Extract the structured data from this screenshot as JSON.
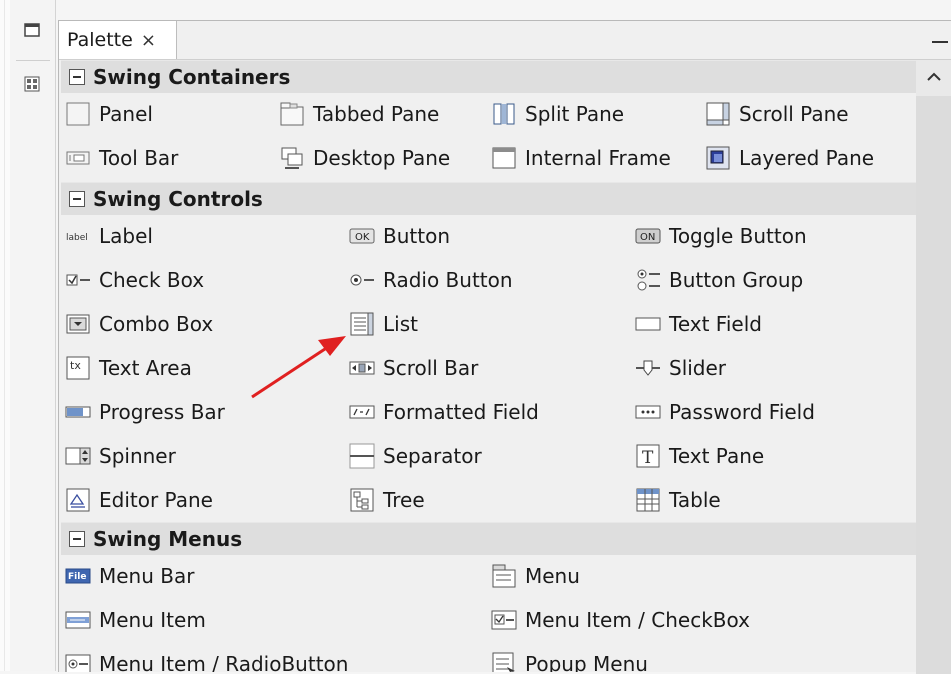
{
  "palette": {
    "tab_label": "Palette",
    "tab_close": "×"
  },
  "colors": {
    "category_bg": "#dedede",
    "panel_bg": "#f0f0f0",
    "annotation_arrow": "#e02020"
  },
  "categories": [
    {
      "label": "Swing Containers"
    },
    {
      "label": "Swing Controls"
    },
    {
      "label": "Swing Menus"
    }
  ],
  "containers": [
    {
      "label": "Panel",
      "icon": "panel-icon"
    },
    {
      "label": "Tabbed Pane",
      "icon": "tabbed-pane-icon"
    },
    {
      "label": "Split Pane",
      "icon": "split-pane-icon"
    },
    {
      "label": "Scroll Pane",
      "icon": "scroll-pane-icon"
    },
    {
      "label": "Tool Bar",
      "icon": "tool-bar-icon"
    },
    {
      "label": "Desktop Pane",
      "icon": "desktop-pane-icon"
    },
    {
      "label": "Internal Frame",
      "icon": "internal-frame-icon"
    },
    {
      "label": "Layered Pane",
      "icon": "layered-pane-icon"
    }
  ],
  "controls": [
    {
      "label": "Label",
      "icon": "label-icon",
      "icon_text": "label"
    },
    {
      "label": "Button",
      "icon": "button-icon",
      "icon_text": "OK"
    },
    {
      "label": "Toggle Button",
      "icon": "toggle-button-icon",
      "icon_text": "ON"
    },
    {
      "label": "Check Box",
      "icon": "check-box-icon"
    },
    {
      "label": "Radio Button",
      "icon": "radio-button-icon"
    },
    {
      "label": "Button Group",
      "icon": "button-group-icon"
    },
    {
      "label": "Combo Box",
      "icon": "combo-box-icon"
    },
    {
      "label": "List",
      "icon": "list-icon"
    },
    {
      "label": "Text Field",
      "icon": "text-field-icon"
    },
    {
      "label": "Text Area",
      "icon": "text-area-icon",
      "icon_text": "tx"
    },
    {
      "label": "Scroll Bar",
      "icon": "scroll-bar-icon"
    },
    {
      "label": "Slider",
      "icon": "slider-icon"
    },
    {
      "label": "Progress Bar",
      "icon": "progress-bar-icon"
    },
    {
      "label": "Formatted Field",
      "icon": "formatted-field-icon"
    },
    {
      "label": "Password Field",
      "icon": "password-field-icon",
      "icon_text": "***"
    },
    {
      "label": "Spinner",
      "icon": "spinner-icon"
    },
    {
      "label": "Separator",
      "icon": "separator-icon"
    },
    {
      "label": "Text Pane",
      "icon": "text-pane-icon",
      "icon_text": "T"
    },
    {
      "label": "Editor Pane",
      "icon": "editor-pane-icon"
    },
    {
      "label": "Tree",
      "icon": "tree-icon"
    },
    {
      "label": "Table",
      "icon": "table-icon"
    }
  ],
  "menus": [
    {
      "label": "Menu Bar",
      "icon": "menu-bar-icon",
      "icon_text": "File"
    },
    {
      "label": "Menu",
      "icon": "menu-icon"
    },
    {
      "label": "Menu Item",
      "icon": "menu-item-icon"
    },
    {
      "label": "Menu Item / CheckBox",
      "icon": "menu-item-checkbox-icon"
    },
    {
      "label": "Menu Item / RadioButton",
      "icon": "menu-item-radiobutton-icon"
    },
    {
      "label": "Popup Menu",
      "icon": "popup-menu-icon"
    }
  ]
}
